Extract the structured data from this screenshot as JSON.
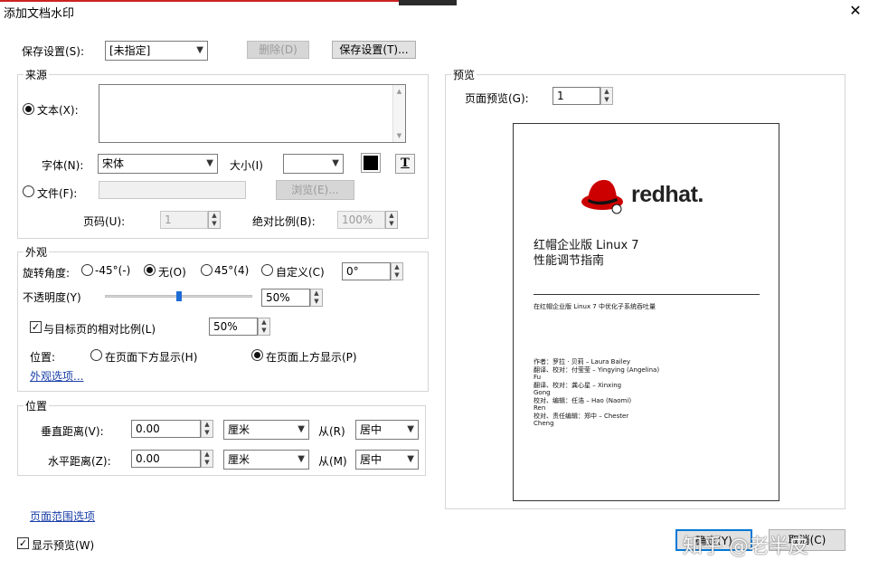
{
  "window": {
    "title": "添加文档水印",
    "close_glyph": "✕"
  },
  "settings": {
    "label": "保存设置(S):",
    "selected": "[未指定]",
    "delete_label": "删除(D)",
    "save_label": "保存设置(T)..."
  },
  "source": {
    "group_label": "来源",
    "text_label": "文本(X):",
    "text_value": "",
    "font_label": "字体(N):",
    "font_value": "宋体",
    "size_label": "大小(I)",
    "size_value": "",
    "text_color": "#000000",
    "text_format_glyph": "T",
    "file_label": "文件(F):",
    "file_value": "",
    "browse_label": "浏览(E)...",
    "page_label": "页码(U):",
    "page_value": "1",
    "scale_label": "绝对比例(B):",
    "scale_value": "100%"
  },
  "appearance": {
    "group_label": "外观",
    "rotation_label": "旋转角度:",
    "rot_options": [
      "-45°(-)",
      "无(O)",
      "45°(4)",
      "自定义(C)"
    ],
    "rot_selected": "无(O)",
    "custom_angle": "0°",
    "opacity_label": "不透明度(Y)",
    "opacity_value": "50%",
    "opacity_fraction": 0.5,
    "relative_label": "与目标页的相对比例(L)",
    "relative_value": "50%",
    "position_label": "位置:",
    "below_label": "在页面下方显示(H)",
    "above_label": "在页面上方显示(P)",
    "more_options": "外观选项..."
  },
  "position": {
    "group_label": "位置",
    "vertical_label": "垂直距离(V):",
    "vertical_value": "0.00",
    "vertical_unit": "厘米",
    "vertical_from_label": "从(R)",
    "vertical_from": "居中",
    "horizontal_label": "水平距离(Z):",
    "horizontal_value": "0.00",
    "horizontal_unit": "厘米",
    "horizontal_from_label": "从(M)",
    "horizontal_from": "居中"
  },
  "page_range_link": "页面范围选项",
  "show_preview_label": "显示预览(W)",
  "preview": {
    "group_label": "预览",
    "page_label": "页面预览(G):",
    "page_value": "1",
    "doc": {
      "brand": "redhat.",
      "title_line1": "红帽企业版 Linux 7",
      "title_line2": "性能调节指南",
      "subtitle": "在红帽企业版 Linux 7 中优化子系统吞吐量",
      "credits": [
        "作者：罗拉 · 贝莉 – Laura Bailey",
        "翻译、校对：付莹莹 – Yingying (Angelina)",
        "Fu",
        "翻译、校对：龚心星 – Xinxing",
        "Gong",
        "校对、编辑：任浩 – Hao (Naomi)",
        "Ren",
        "校对、责任编辑：郑中 – Chester",
        "Cheng"
      ]
    }
  },
  "footer": {
    "ok_label": "确定(Y)",
    "cancel_label": "取消(C)",
    "watermark_text": "知乎 @老半皮"
  }
}
